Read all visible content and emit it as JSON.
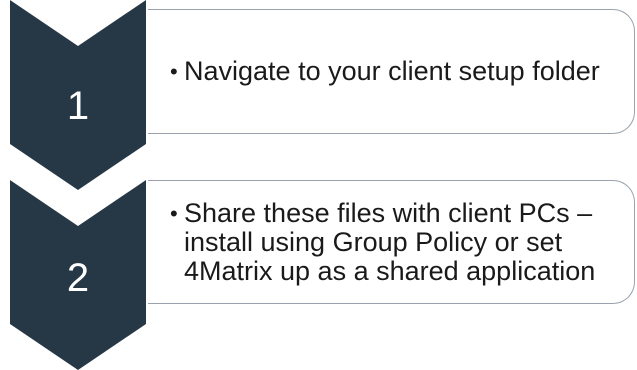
{
  "colors": {
    "chevron_fill": "#263746",
    "box_border": "#9aa3ad",
    "number_text": "#ffffff",
    "body_text": "#1a1a1a"
  },
  "steps": [
    {
      "number": "1",
      "bullet": "•",
      "text": "Navigate to your client setup folder"
    },
    {
      "number": "2",
      "bullet": "•",
      "text": "Share these files with client PCs – install using Group Policy or set 4Matrix up as a shared application"
    }
  ],
  "trailing_chevron_icon": "chevron-down-icon"
}
